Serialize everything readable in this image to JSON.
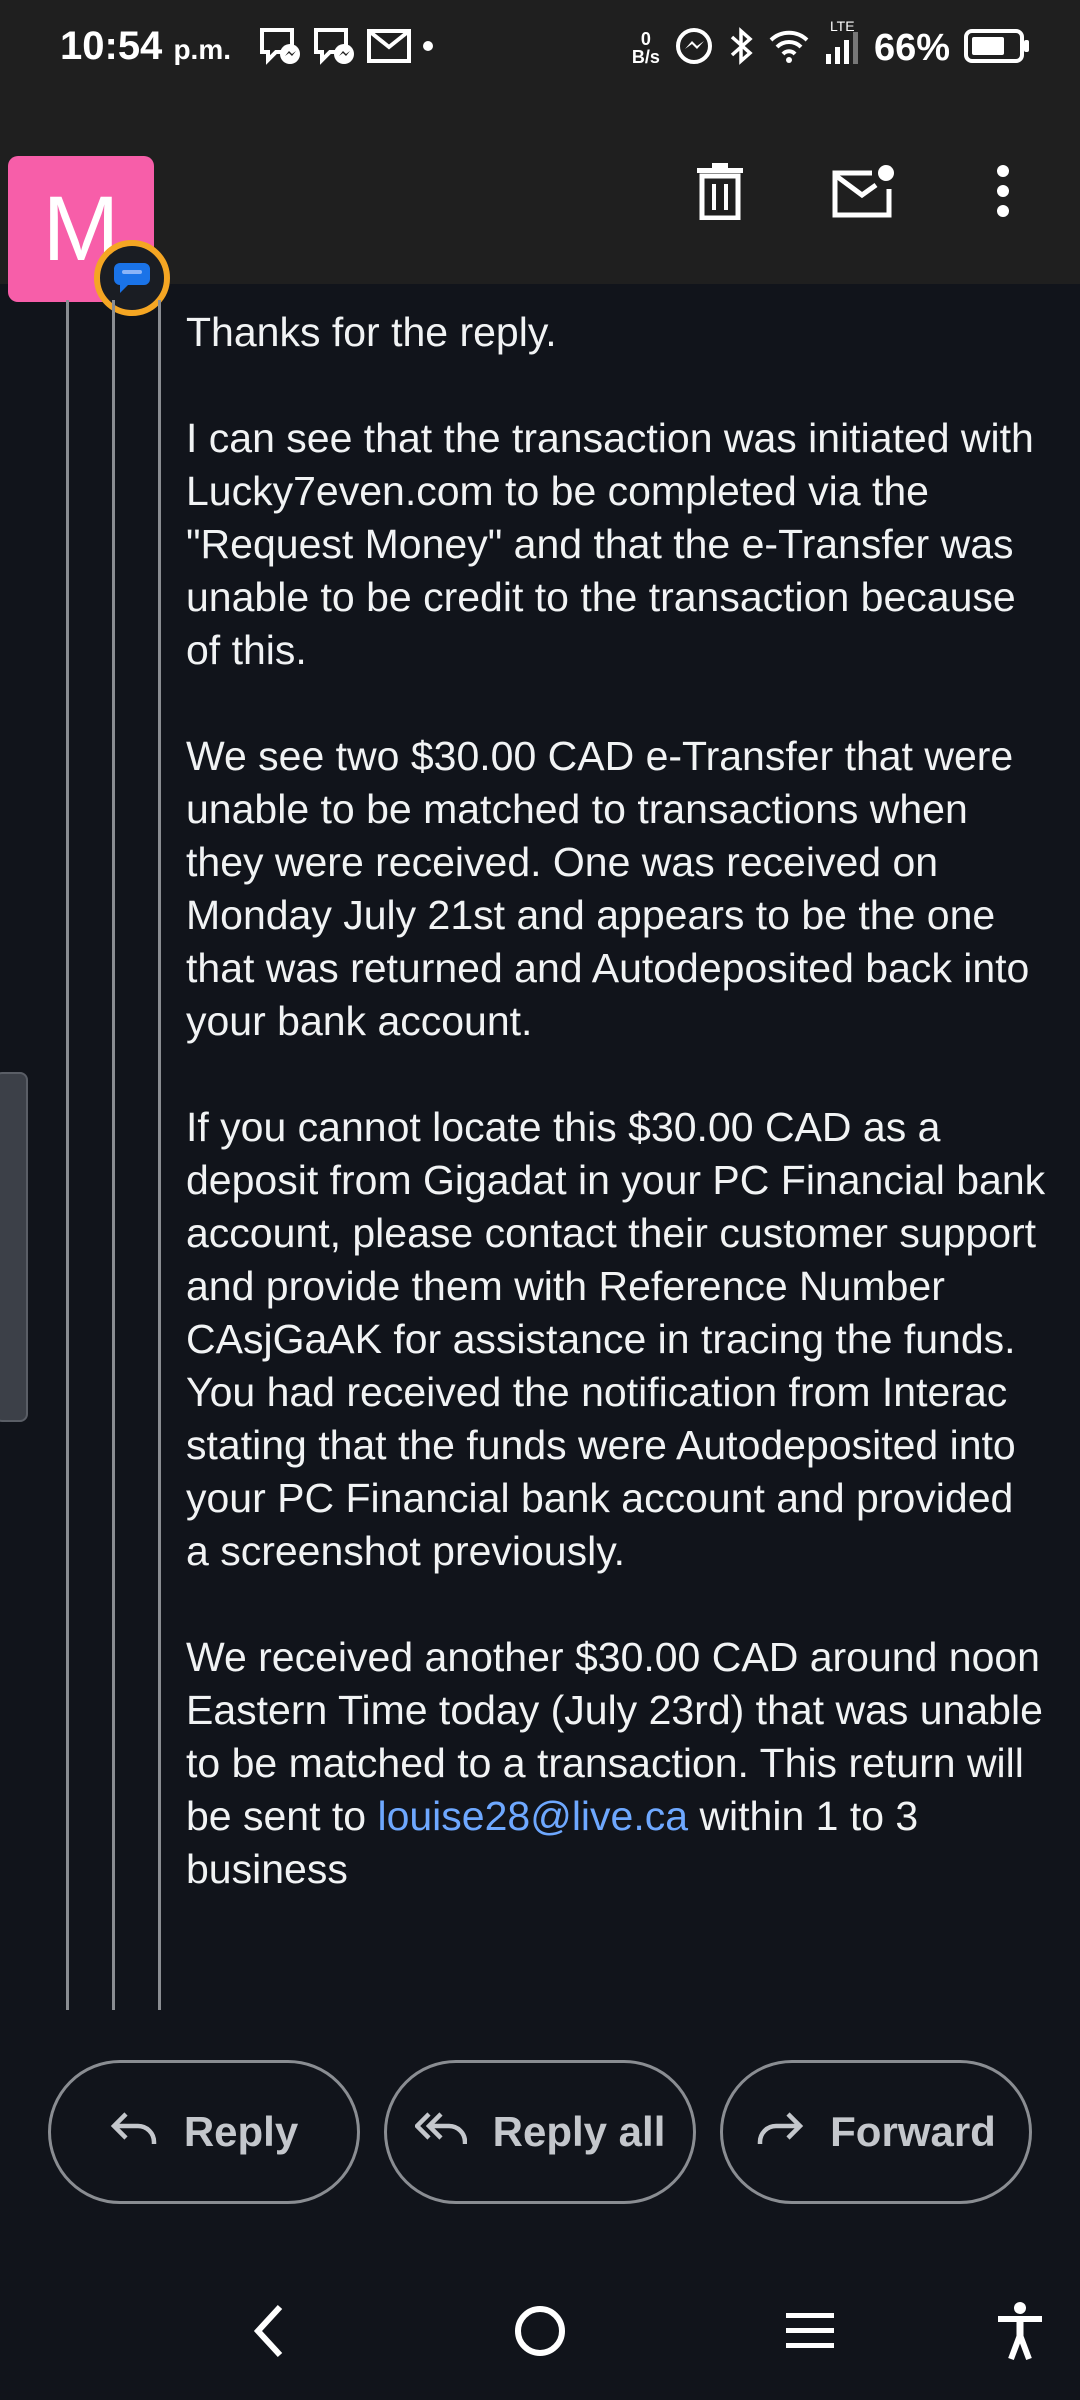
{
  "status_bar": {
    "time": "10:54",
    "ampm": "p.m.",
    "net_speed_value": "0",
    "net_speed_unit": "B/s",
    "network_label": "LTE",
    "battery": "66%",
    "notification_icons": [
      "messenger-icon",
      "messenger-icon",
      "mail-icon",
      "dot-icon"
    ],
    "system_icons": [
      "data-speed",
      "messenger-icon",
      "bluetooth-icon",
      "wifi-icon",
      "signal-icon",
      "battery-icon"
    ]
  },
  "toolbar": {
    "actions": [
      "delete-icon",
      "mark-unread-icon",
      "more-options-icon"
    ]
  },
  "sender": {
    "avatar_letter": "M",
    "avatar_color": "#f75ea9",
    "badge_color": "#f5a623"
  },
  "message": {
    "paragraphs": [
      "Thanks for the reply.",
      "I can see that the transaction was initiated with Lucky7even.com to be completed via the \"Request Money\" and that the e-Transfer was unable to be credit to the transaction because of this.",
      "We see two $30.00 CAD e-Transfer that were unable to be matched to transactions when they were received. One was received on Monday July 21st and appears to be the one that was returned and Autodeposited back into your bank account.",
      "If you cannot locate this $30.00 CAD as a deposit from Gigadat in your PC Financial bank account, please contact their customer support and provide them with Reference Number CAsjGaAK for assistance in tracing the funds. You had received the notification from Interac stating that the funds were Autodeposited into your PC Financial bank account and provided a screenshot previously."
    ],
    "last_paragraph_before_link": "We received another $30.00 CAD around noon Eastern Time today (July 23rd) that was unable to be matched to a transaction. This return will be sent to ",
    "email_link": "louise28@live.ca",
    "last_paragraph_after_link": " within 1 to 3 business",
    "link_color": "#6ea8ff"
  },
  "actions": {
    "reply": "Reply",
    "reply_all": "Reply all",
    "forward": "Forward"
  },
  "nav_bar": {
    "buttons": [
      "back-icon",
      "home-icon",
      "recents-icon",
      "accessibility-icon"
    ]
  }
}
